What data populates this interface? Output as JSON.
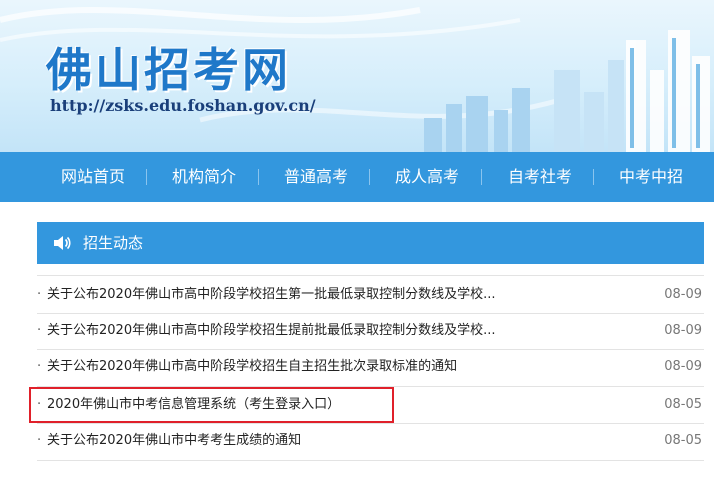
{
  "header": {
    "site_title": "佛山招考网",
    "site_url": "http://zsks.edu.foshan.gov.cn/"
  },
  "nav": {
    "items": [
      {
        "label": "网站首页"
      },
      {
        "label": "机构简介"
      },
      {
        "label": "普通高考"
      },
      {
        "label": "成人高考"
      },
      {
        "label": "自考社考"
      },
      {
        "label": "中考中招"
      }
    ]
  },
  "news": {
    "section_title": "招生动态",
    "bullet": "·",
    "items": [
      {
        "title": "关于公布2020年佛山市高中阶段学校招生第一批最低录取控制分数线及学校...",
        "date": "08-09"
      },
      {
        "title": "关于公布2020年佛山市高中阶段学校招生提前批最低录取控制分数线及学校...",
        "date": "08-09"
      },
      {
        "title": "关于公布2020年佛山市高中阶段学校招生自主招生批次录取标准的通知",
        "date": "08-09"
      },
      {
        "title": "2020年佛山市中考信息管理系统（考生登录入口）",
        "date": "08-05"
      },
      {
        "title": "关于公布2020年佛山市中考考生成绩的通知",
        "date": "08-05"
      }
    ]
  },
  "colors": {
    "nav_bg": "#3397de",
    "title_blue": "#1f78c9",
    "highlight_border": "#e0202a"
  },
  "icons": {
    "speaker": "speaker-icon"
  }
}
